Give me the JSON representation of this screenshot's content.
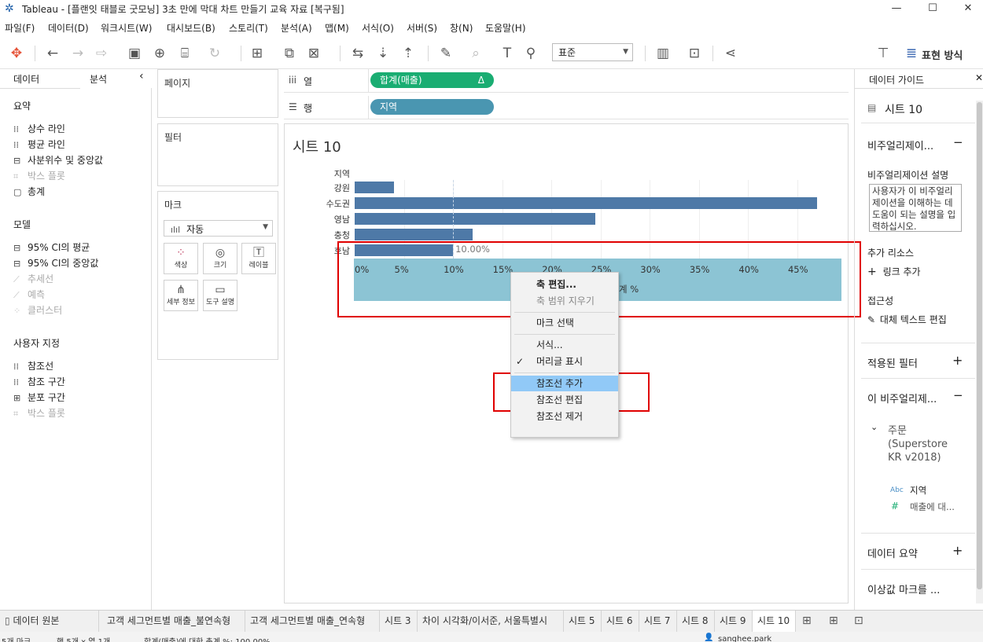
{
  "window": {
    "title": "Tableau - [플랜잇 태블로 굿모닝] 3초 만에 막대 차트 만들기 교육 자료 [복구됨]",
    "min": "—",
    "max": "☐",
    "close": "✕"
  },
  "menubar": [
    "파일(F)",
    "데이터(D)",
    "워크시트(W)",
    "대시보드(B)",
    "스토리(T)",
    "분석(A)",
    "맵(M)",
    "서식(O)",
    "서버(S)",
    "창(N)",
    "도움말(H)"
  ],
  "toolbar": {
    "standard_select": "표준",
    "show_me_label": "표현 방식"
  },
  "left_pane": {
    "tabs": [
      "데이터",
      "분석"
    ],
    "collapse": "‹",
    "summary": {
      "heading": "요약",
      "items": [
        {
          "label": "상수 라인",
          "disabled": false
        },
        {
          "label": "평균 라인",
          "disabled": false
        },
        {
          "label": "사분위수 및 중앙값",
          "disabled": false
        },
        {
          "label": "박스 플롯",
          "disabled": true
        },
        {
          "label": "총계",
          "disabled": false
        }
      ]
    },
    "model": {
      "heading": "모델",
      "items": [
        {
          "label": "95% CI의 평균",
          "disabled": false
        },
        {
          "label": "95% CI의 중앙값",
          "disabled": false
        },
        {
          "label": "추세선",
          "disabled": true
        },
        {
          "label": "예측",
          "disabled": true
        },
        {
          "label": "클러스터",
          "disabled": true
        }
      ]
    },
    "custom": {
      "heading": "사용자 지정",
      "items": [
        {
          "label": "참조선",
          "disabled": false
        },
        {
          "label": "참조 구간",
          "disabled": false
        },
        {
          "label": "분포 구간",
          "disabled": false
        },
        {
          "label": "박스 플롯",
          "disabled": true
        }
      ]
    }
  },
  "cards": {
    "pages": "페이지",
    "filters": "필터",
    "marks": {
      "heading": "마크",
      "type": "자동",
      "buttons": [
        "색상",
        "크기",
        "레이블",
        "세부 정보",
        "도구 설명"
      ]
    }
  },
  "shelves": {
    "columns_label": "열",
    "columns_pill": "합계(매출)",
    "columns_delta": "Δ",
    "rows_label": "행",
    "rows_pill": "지역"
  },
  "viz": {
    "sheet_title": "시트 10",
    "row_header": "지역",
    "reference_label": "10.00%",
    "axis_title_partial": "계 %"
  },
  "chart_data": {
    "type": "bar",
    "orientation": "horizontal",
    "categories": [
      "강원",
      "수도권",
      "영남",
      "충청",
      "호남"
    ],
    "values": [
      4.0,
      47.0,
      24.5,
      12.0,
      10.0
    ],
    "xlabel": "계 %",
    "ylabel": "지역",
    "xlim": [
      0,
      48
    ],
    "x_ticks": [
      "0%",
      "5%",
      "10%",
      "15%",
      "20%",
      "25%",
      "30%",
      "35%",
      "40%",
      "45%"
    ],
    "reference_line": {
      "value": 10,
      "label": "10.00%"
    },
    "grid": true
  },
  "context_menu": {
    "items": [
      {
        "label": "축 편집...",
        "bold": true,
        "disabled": false,
        "checked": false,
        "highlight": false
      },
      {
        "label": "축 범위 지우기",
        "bold": false,
        "disabled": true,
        "checked": false,
        "highlight": false
      },
      {
        "sep": true
      },
      {
        "label": "마크 선택",
        "bold": false,
        "disabled": false,
        "checked": false,
        "highlight": false
      },
      {
        "sep": true
      },
      {
        "label": "서식...",
        "bold": false,
        "disabled": false,
        "checked": false,
        "highlight": false
      },
      {
        "label": "머리글 표시",
        "bold": false,
        "disabled": false,
        "checked": true,
        "highlight": false
      },
      {
        "sep": true
      },
      {
        "label": "참조선 추가",
        "bold": false,
        "disabled": false,
        "checked": false,
        "highlight": true
      },
      {
        "label": "참조선 편집",
        "bold": false,
        "disabled": false,
        "checked": false,
        "highlight": false
      },
      {
        "label": "참조선 제거",
        "bold": false,
        "disabled": false,
        "checked": false,
        "highlight": false
      }
    ]
  },
  "right_pane": {
    "title": "데이터 가이드",
    "sheet": "시트 10",
    "viz_section": "비주얼리제이...",
    "viz_desc_label": "비주얼리제이션 설명",
    "viz_desc_placeholder": "사용자가 이 비주얼리제이션을 이해하는 데 도움이 되는 설명을 입력하십시오.",
    "extra_resources": "추가 리소스",
    "add_link": "링크 추가",
    "accessibility": "접근성",
    "alt_text": "대체 텍스트 편집",
    "applied_filters": "적용된 필터",
    "this_viz": "이 비주얼리제...",
    "datasource": "주문\n(Superstore\nKR v2018)",
    "field1_type": "Abc",
    "field1": "지역",
    "field2_type": "#",
    "field2": "매출에 대...",
    "data_summary": "데이터 요약",
    "outliers": "이상값 마크를 ..."
  },
  "sheet_tabs": [
    "데이터 원본",
    "고객 세그먼트별 매출_불연속형",
    "고객 세그먼트별 매출_연속형",
    "시트 3",
    "차이 시각화/이서준, 서울특별시",
    "시트 5",
    "시트 6",
    "시트 7",
    "시트 8",
    "시트 9",
    "시트 10"
  ],
  "active_tab": "시트 10",
  "status": {
    "marks": "5개 마크",
    "rows_cols": "행 5개 x 열 1개",
    "summary": "합계(매출)에 대한 총계 %: 100.00%",
    "user": "sanghee.park"
  },
  "colors": {
    "bar": "#4e79a7",
    "axis_highlight": "#8cc4d4",
    "green_pill": "#1aad72",
    "blue_pill": "#4a96b1",
    "red_box": "#e00000",
    "menu_highlight": "#91c9f7"
  }
}
